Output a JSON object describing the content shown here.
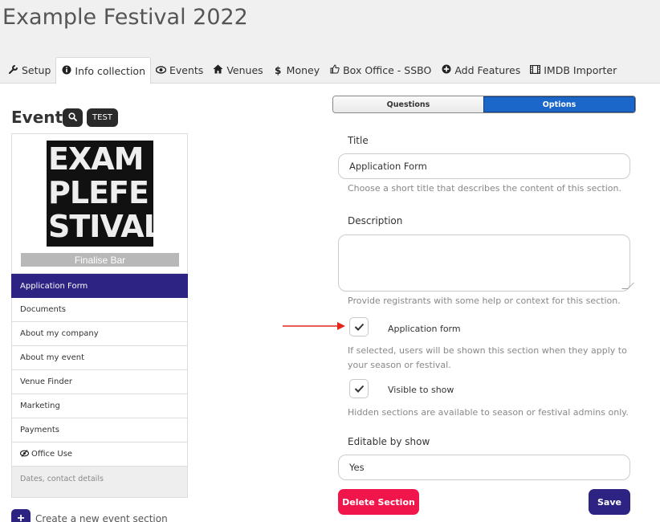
{
  "page": {
    "title": "Example Festival 2022"
  },
  "tabs": [
    {
      "label": "Setup",
      "icon": "wrench-icon"
    },
    {
      "label": "Info collection",
      "icon": "info-circle-icon"
    },
    {
      "label": "Events",
      "icon": "eye-icon"
    },
    {
      "label": "Venues",
      "icon": "home-icon"
    },
    {
      "label": "Money",
      "icon": "dollar-icon"
    },
    {
      "label": "Box Office - SSBO",
      "icon": "thumbs-up-icon"
    },
    {
      "label": "Add Features",
      "icon": "plus-circle-icon"
    },
    {
      "label": "IMDB Importer",
      "icon": "film-icon"
    }
  ],
  "active_tab": "Info collection",
  "left": {
    "heading": "Events",
    "test_label": "TEST",
    "logo_lines": [
      "EXAM",
      "PLEFE",
      "STIVAL"
    ],
    "finalise_label": "Finalise Bar",
    "sections": [
      {
        "label": "Application Form",
        "active": true
      },
      {
        "label": "Documents"
      },
      {
        "label": "About my company"
      },
      {
        "label": "About my event"
      },
      {
        "label": "Venue Finder"
      },
      {
        "label": "Marketing"
      },
      {
        "label": "Payments"
      },
      {
        "label": "Office Use",
        "icon": "eye-slash-icon"
      }
    ],
    "footer_text": "Dates, contact details",
    "create_label": "Create a new event section"
  },
  "segmented": {
    "questions_label": "Questions",
    "options_label": "Options",
    "selected": "Options"
  },
  "form": {
    "title_label": "Title",
    "title_value": "Application Form",
    "title_help": "Choose a short title that describes the content of this section.",
    "description_label": "Description",
    "description_value": "",
    "description_help": "Provide registrants with some help or context for this section.",
    "application_form_label": "Application form",
    "application_form_checked": true,
    "application_form_help_1": "If selected, users will be shown this section when they apply to",
    "application_form_help_2": "your season or festival.",
    "visible_label": "Visible to show",
    "visible_checked": true,
    "visible_help": "Hidden sections are available to season or festival admins only.",
    "editable_label": "Editable by show",
    "editable_value": "Yes",
    "delete_label": "Delete Section",
    "save_label": "Save"
  },
  "colors": {
    "accent": "#2d2383",
    "toggle_on": "#1a66c9",
    "danger": "#f0154a",
    "annotation_arrow": "#e0261b"
  }
}
